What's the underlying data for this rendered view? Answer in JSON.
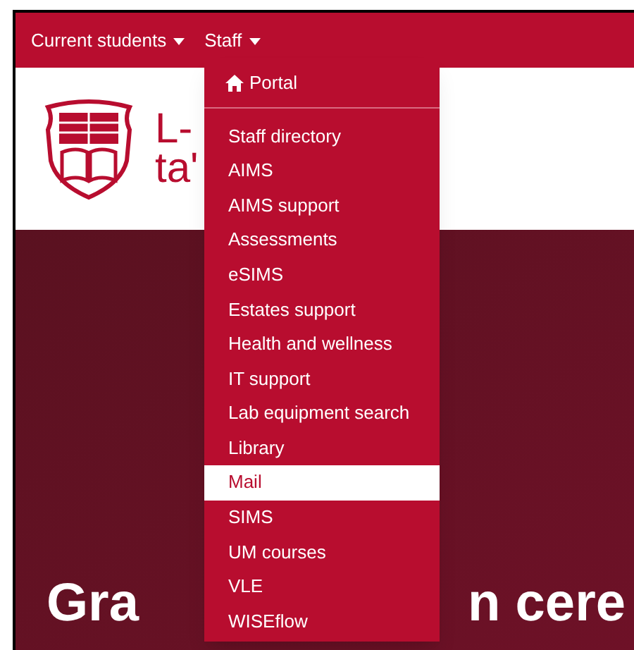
{
  "navbar": {
    "items": [
      {
        "label": "Current students"
      },
      {
        "label": "Staff"
      }
    ]
  },
  "header": {
    "title_lines": [
      "L-",
      "ta'"
    ]
  },
  "dropdown": {
    "portal": "Portal",
    "items": [
      {
        "label": "Staff directory",
        "selected": false
      },
      {
        "label": "AIMS",
        "selected": false
      },
      {
        "label": "AIMS support",
        "selected": false
      },
      {
        "label": "Assessments",
        "selected": false
      },
      {
        "label": "eSIMS",
        "selected": false
      },
      {
        "label": "Estates support",
        "selected": false
      },
      {
        "label": "Health and wellness",
        "selected": false
      },
      {
        "label": "IT support",
        "selected": false
      },
      {
        "label": "Lab equipment search",
        "selected": false
      },
      {
        "label": "Library",
        "selected": false
      },
      {
        "label": "Mail",
        "selected": true
      },
      {
        "label": "SIMS",
        "selected": false
      },
      {
        "label": "UM courses",
        "selected": false
      },
      {
        "label": "VLE",
        "selected": false
      },
      {
        "label": "WISEflow",
        "selected": false
      }
    ]
  },
  "hero": {
    "heading_parts": [
      "Gra",
      "n cere"
    ]
  }
}
